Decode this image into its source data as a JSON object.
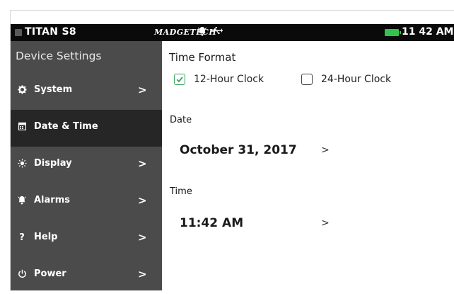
{
  "status_bar": {
    "device": "TITAN S8",
    "brand": "MADGETECH",
    "alarm_icon": "alarm-bell-icon",
    "usb_icon": "usb-icon",
    "battery_color": "#33c24d",
    "time": "11 42 AM"
  },
  "sidebar": {
    "title": "Device Settings",
    "items": [
      {
        "label": "System",
        "icon": "gear-icon",
        "chevron": ">"
      },
      {
        "label": "Date & Time",
        "icon": "calendar-icon",
        "chevron": ""
      },
      {
        "label": "Display",
        "icon": "sun-icon",
        "chevron": ">"
      },
      {
        "label": "Alarms",
        "icon": "alarm-bell-icon",
        "chevron": ">"
      },
      {
        "label": "Help",
        "icon": "question-icon",
        "chevron": ">"
      },
      {
        "label": "Power",
        "icon": "power-icon",
        "chevron": ">"
      }
    ]
  },
  "main": {
    "time_format": {
      "label": "Time Format",
      "options": [
        {
          "label": "12-Hour Clock",
          "checked": true
        },
        {
          "label": "24-Hour Clock",
          "checked": false
        }
      ]
    },
    "date": {
      "label": "Date",
      "value": "October 31, 2017",
      "chevron": ">"
    },
    "time": {
      "label": "Time",
      "value": "11:42 AM",
      "chevron": ">"
    }
  },
  "colors": {
    "accent_check": "#3aa35a",
    "sidebar_bg": "#4b4b4b",
    "active_bg": "#262626"
  }
}
